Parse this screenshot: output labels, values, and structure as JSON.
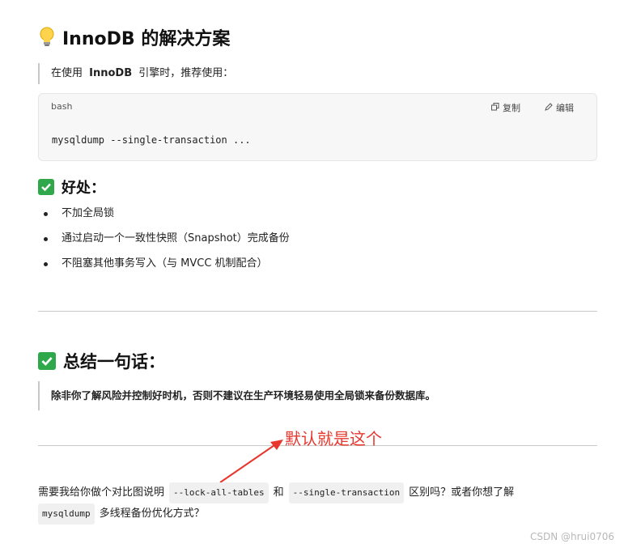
{
  "section1": {
    "title": "InnoDB 的解决方案",
    "quote_prefix": "在使用",
    "quote_bold": "InnoDB",
    "quote_suffix": "引擎时，推荐使用："
  },
  "codeblock": {
    "language": "bash",
    "copy_label": "复制",
    "edit_label": "编辑",
    "code": "mysqldump --single-transaction ..."
  },
  "benefits": {
    "title": "好处：",
    "items": [
      "不加全局锁",
      "通过启动一个一致性快照（Snapshot）完成备份",
      "不阻塞其他事务写入（与 MVCC 机制配合）"
    ]
  },
  "summary": {
    "title": "总结一句话：",
    "quote": "除非你了解风险并控制好时机，否则不建议在生产环境轻易使用全局锁来备份数据库。"
  },
  "annotation": {
    "text": "默认就是这个",
    "color": "#e8362d"
  },
  "closing": {
    "part1": "需要我给你做个对比图说明",
    "code1": "--lock-all-tables",
    "part2": "和",
    "code2": "--single-transaction",
    "part3": "区别吗？或者你想了解",
    "code3": "mysqldump",
    "part4": "多线程备份优化方式？"
  },
  "watermark": "CSDN @hrui0706",
  "colors": {
    "check_green": "#2ea84a",
    "annotation_red": "#e8362d"
  }
}
